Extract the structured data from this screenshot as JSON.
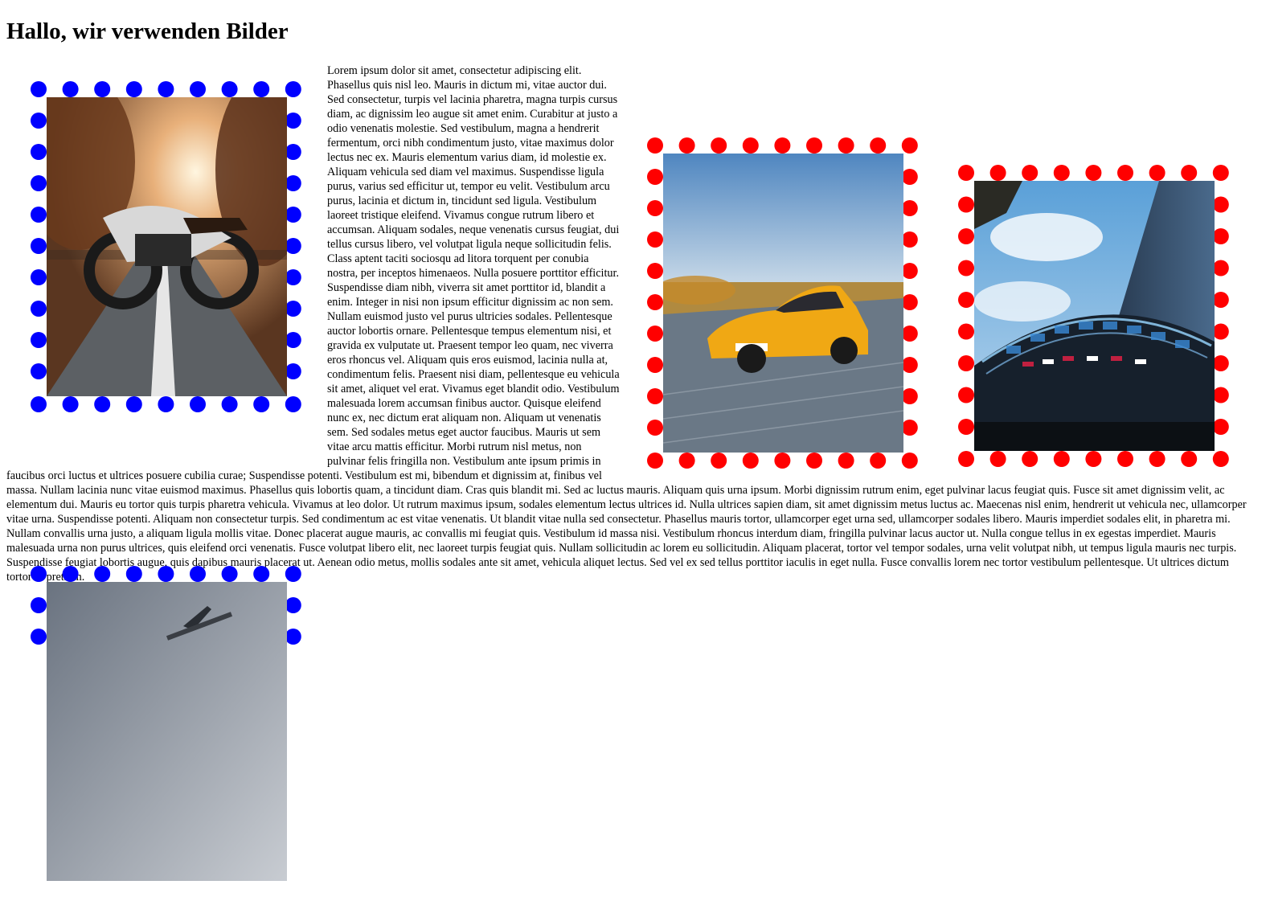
{
  "heading": "Hallo, wir verwenden Bilder",
  "body_text": "Lorem ipsum dolor sit amet, consectetur adipiscing elit. Phasellus quis nisl leo. Mauris in dictum mi, vitae auctor dui. Sed consectetur, turpis vel lacinia pharetra, magna turpis cursus diam, ac dignissim leo augue sit amet enim. Curabitur at justo a odio venenatis molestie. Sed vestibulum, magna a hendrerit fermentum, orci nibh condimentum justo, vitae maximus dolor lectus nec ex. Mauris elementum varius diam, id molestie ex. Aliquam vehicula sed diam vel maximus. Suspendisse ligula purus, varius sed efficitur ut, tempor eu velit. Vestibulum arcu purus, lacinia et dictum in, tincidunt sed ligula. Vestibulum laoreet tristique eleifend. Vivamus congue rutrum libero et accumsan. Aliquam sodales, neque venenatis cursus feugiat, dui tellus cursus libero, vel volutpat ligula neque sollicitudin felis. Class aptent taciti sociosqu ad litora torquent per conubia nostra, per inceptos himenaeos. Nulla posuere porttitor efficitur. Suspendisse diam nibh, viverra sit amet porttitor id, blandit a enim. Integer in nisi non ipsum efficitur dignissim ac non sem. Nullam euismod justo vel purus ultricies sodales. Pellentesque auctor lobortis ornare. Pellentesque tempus elementum nisi, et gravida ex vulputate ut. Praesent tempor leo quam, nec viverra eros rhoncus vel. Aliquam quis eros euismod, lacinia nulla at, condimentum felis. Praesent nisi diam, pellentesque eu vehicula sit amet, aliquet vel erat. Vivamus eget blandit odio. Vestibulum malesuada lorem accumsan finibus auctor. Quisque eleifend nunc ex, nec dictum erat aliquam non. Aliquam ut venenatis sem. Sed sodales metus eget auctor faucibus. Mauris ut sem vitae arcu mattis efficitur. Morbi rutrum nisl metus, non pulvinar felis fringilla non. Vestibulum ante ipsum primis in faucibus orci luctus et ultrices posuere cubilia curae; Suspendisse potenti. Vestibulum est mi, bibendum et dignissim at, finibus vel massa. Nullam lacinia nunc vitae euismod maximus. Phasellus quis lobortis quam, a tincidunt diam. Cras quis blandit mi. Sed ac luctus mauris. Aliquam quis urna ipsum. Morbi dignissim rutrum enim, eget pulvinar lacus feugiat quis. Fusce sit amet dignissim velit, ac elementum dui. Mauris eu tortor quis turpis pharetra vehicula. Vivamus at leo dolor. Ut rutrum maximus ipsum, sodales elementum lectus ultrices id. Nulla ultrices sapien diam, sit amet dignissim metus luctus ac. Maecenas nisl enim, hendrerit ut vehicula nec, ullamcorper vitae urna. Suspendisse potenti. Aliquam non consectetur turpis. Sed condimentum ac est vitae venenatis. Ut blandit vitae nulla sed consectetur. Phasellus mauris tortor, ullamcorper eget urna sed, ullamcorper sodales libero. Mauris imperdiet sodales elit, in pharetra mi. Nullam convallis urna justo, a aliquam ligula mollis vitae. Donec placerat augue mauris, ac convallis mi feugiat quis. Vestibulum id massa nisi. Vestibulum rhoncus interdum diam, fringilla pulvinar lacus auctor ut. Nulla congue tellus in ex egestas imperdiet. Mauris malesuada urna non purus ultrices, quis eleifend orci venenatis. Fusce volutpat libero elit, nec laoreet turpis feugiat quis. Nullam sollicitudin ac lorem eu sollicitudin. Aliquam placerat, tortor vel tempor sodales, urna velit volutpat nibh, ut tempus ligula mauris nec turpis. Suspendisse feugiat lobortis augue, quis dapibus mauris placerat ut. Aenean odio metus, mollis sodales ante sit amet, vehicula aliquet lectus. Sed vel ex sed tellus porttitor iaculis in eget nulla. Fusce convallis lorem nec tortor vestibulum pellentesque. Ut ultrices dictum tortor id pretium.",
  "images": {
    "motorcycle": {
      "subject": "motorcycle on tree-lined road",
      "frame_color": "#0000ff"
    },
    "sportscar": {
      "subject": "yellow sports car on road",
      "frame_color": "#ff0000"
    },
    "building": {
      "subject": "glass skyscraper with dome",
      "frame_color": "#ff0000"
    },
    "airplane": {
      "subject": "airplane in grey sky",
      "frame_color": "#0000ff"
    }
  }
}
